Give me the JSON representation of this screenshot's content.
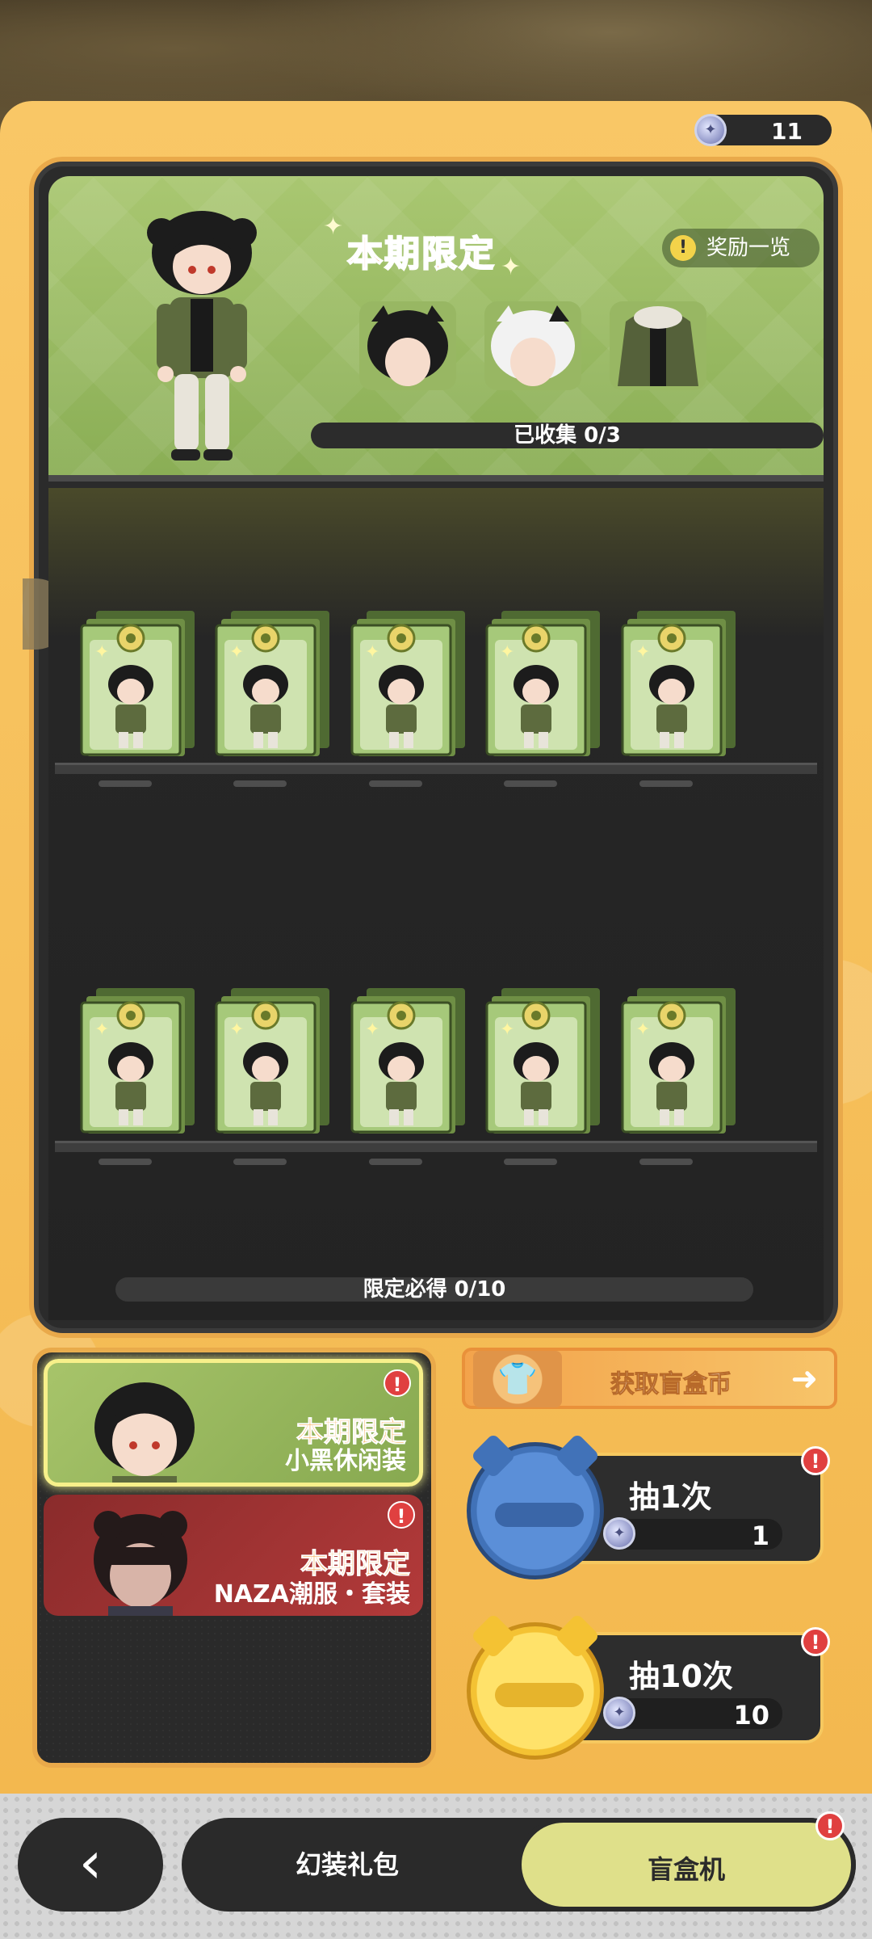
{
  "currency": {
    "value": "11"
  },
  "banner": {
    "title": "本期限定",
    "reward_button": "奖励一览",
    "collect_progress": "已收集 0/3"
  },
  "machine": {
    "guarantee": "限定必得 0/10",
    "row1_count": 5,
    "row2_count": 5
  },
  "pools": [
    {
      "tag": "本期限定",
      "name": "小黑休闲装",
      "selected": true
    },
    {
      "tag": "本期限定",
      "name": "NAZA潮服・套装",
      "selected": false
    }
  ],
  "get_coin": {
    "label": "获取盲盒币"
  },
  "draw_once": {
    "label": "抽1次",
    "cost": "1"
  },
  "draw_ten": {
    "label": "抽10次",
    "cost": "10"
  },
  "nav": {
    "tab_gift": "幻装礼包",
    "tab_blindbox": "盲盒机",
    "active_tab": "盲盒机"
  },
  "colors": {
    "panel": "#f9c766",
    "banner_green": "#a9c771",
    "machine_dark": "#2b2b2b",
    "accent_orange": "#e87a2a",
    "active_tab": "#dfe08a",
    "alert_red": "#e04040"
  }
}
